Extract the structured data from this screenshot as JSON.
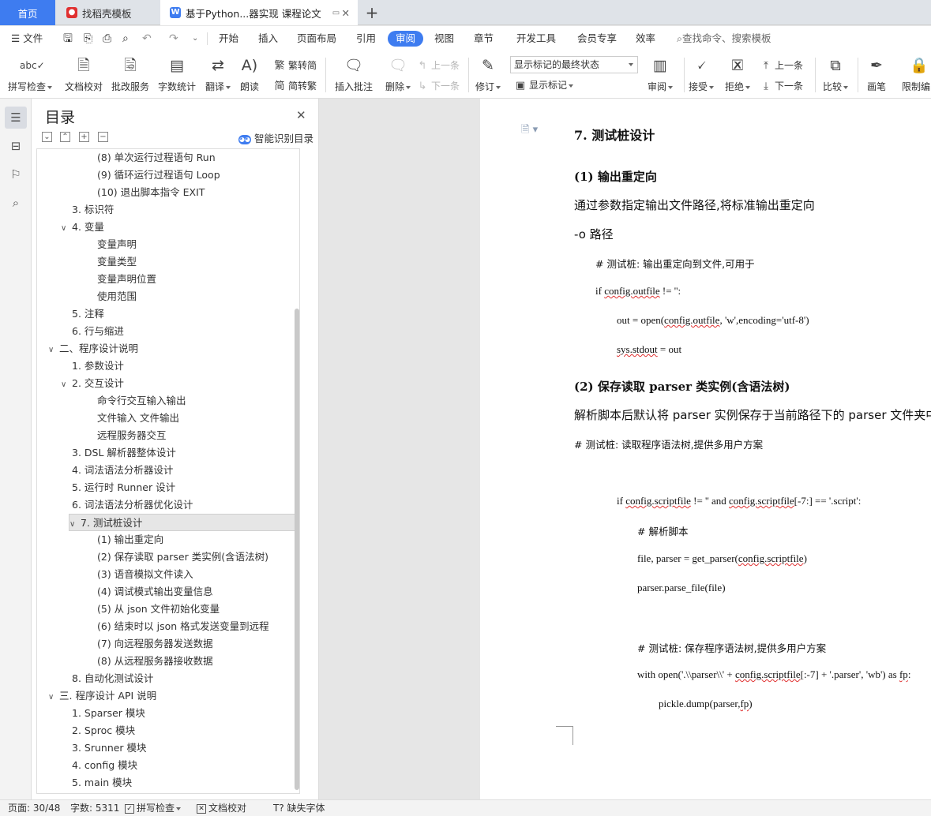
{
  "tabs": {
    "home": "首页",
    "template": "找稻壳模板",
    "document": "基于Python...器实现 课程论文",
    "new_tab": "+"
  },
  "menu": {
    "file": "文件",
    "items": [
      "开始",
      "插入",
      "页面布局",
      "引用",
      "审阅",
      "视图",
      "章节",
      "开发工具",
      "会员专享",
      "效率"
    ],
    "active": "审阅",
    "search": "查找命令、搜索模板"
  },
  "toolbar": {
    "spell_check": "拼写检查",
    "doc_proof": "文档校对",
    "batch_service": "批改服务",
    "word_count": "字数统计",
    "translate": "翻译",
    "read_aloud": "朗读",
    "to_traditional": "繁转简",
    "to_simplified": "简转繁",
    "insert_comment": "插入批注",
    "delete": "删除",
    "prev_comment": "上一条",
    "next_comment": "下一条",
    "track_changes": "修订",
    "mark_state": "显示标记的最终状态",
    "show_markup": "显示标记",
    "review": "审阅",
    "accept": "接受",
    "reject": "拒绝",
    "prev_change": "上一条",
    "next_change": "下一条",
    "compare": "比较",
    "pen": "画笔",
    "restrict_edit": "限制编"
  },
  "toc": {
    "title": "目录",
    "smart_toc": "智能识别目录",
    "items": [
      {
        "label": "(8) 单次运行过程语句 Run",
        "level": 3
      },
      {
        "label": "(9) 循环运行过程语句 Loop",
        "level": 3
      },
      {
        "label": "(10) 退出脚本指令 EXIT",
        "level": 3
      },
      {
        "label": "3. 标识符",
        "level": 2
      },
      {
        "label": "4. 变量",
        "level": 2,
        "expanded": true
      },
      {
        "label": "变量声明",
        "level": 3
      },
      {
        "label": "变量类型",
        "level": 3
      },
      {
        "label": "变量声明位置",
        "level": 3
      },
      {
        "label": "使用范围",
        "level": 3
      },
      {
        "label": "5. 注释",
        "level": 2
      },
      {
        "label": "6. 行与缩进",
        "level": 2
      },
      {
        "label": "二、程序设计说明",
        "level": 1,
        "expanded": true
      },
      {
        "label": "1. 参数设计",
        "level": 2
      },
      {
        "label": "2. 交互设计",
        "level": 2,
        "expanded": true
      },
      {
        "label": "命令行交互输入输出",
        "level": 3
      },
      {
        "label": "文件输入  文件输出",
        "level": 3
      },
      {
        "label": "远程服务器交互",
        "level": 3
      },
      {
        "label": "3. DSL 解析器整体设计",
        "level": 2
      },
      {
        "label": "4. 词法语法分析器设计",
        "level": 2
      },
      {
        "label": "5. 运行时 Runner 设计",
        "level": 2
      },
      {
        "label": "6. 词法语法分析器优化设计",
        "level": 2
      },
      {
        "label": "7. 测试桩设计",
        "level": 2,
        "expanded": true,
        "selected": true
      },
      {
        "label": "(1) 输出重定向",
        "level": 3
      },
      {
        "label": "(2) 保存读取 parser 类实例(含语法树)",
        "level": 3
      },
      {
        "label": "(3) 语音模拟文件读入",
        "level": 3
      },
      {
        "label": "(4) 调试模式输出变量信息",
        "level": 3
      },
      {
        "label": "(5) 从 json 文件初始化变量",
        "level": 3
      },
      {
        "label": "(6) 结束时以 json 格式发送变量到远程",
        "level": 3
      },
      {
        "label": "(7) 向远程服务器发送数据",
        "level": 3
      },
      {
        "label": "(8) 从远程服务器接收数据",
        "level": 3
      },
      {
        "label": "8. 自动化测试设计",
        "level": 2
      },
      {
        "label": "三. 程序设计 API 说明",
        "level": 1,
        "expanded": true
      },
      {
        "label": "1. Sparser  模块",
        "level": 2
      },
      {
        "label": "2. Sproc  模块",
        "level": 2
      },
      {
        "label": "3. Srunner  模块",
        "level": 2
      },
      {
        "label": "4. config  模块",
        "level": 2
      },
      {
        "label": "5. main  模块",
        "level": 2
      }
    ]
  },
  "document": {
    "heading": "7.  测试桩设计",
    "sub1": "(1)  输出重定向",
    "p1": "通过参数指定输出文件路径,将标准输出重定向",
    "p2": "-o  路径",
    "c1_comment": "#  测试桩: 输出重定向到文件,可用于",
    "c1_l1": "if config.outfile != '':",
    "c1_l2": "out = open(config.outfile, 'w',encoding='utf-8')",
    "c1_l3": "sys.stdout = out",
    "sub2": "(2)  保存读取 parser 类实例(含语法树)",
    "p3": "解析脚本后默认将 parser 实例保存于当前路径下的 parser 文件夹中",
    "c2_comment": "#  测试桩: 读取程序语法树,提供多用户方案",
    "c2_l1": "if config.scriptfile != '' and config.scriptfile[-7:] == '.script':",
    "c2_l2": "#  解析脚本",
    "c2_l3": "file, parser = get_parser(config.scriptfile)",
    "c2_l4": "parser.parse_file(file)",
    "c2_l5": "#  测试桩: 保存程序语法树,提供多用户方案",
    "c2_l6": "with open('.\\\\parser\\\\' + config.scriptfile[:-7] + '.parser', 'wb') as fp:",
    "c2_l7": "pickle.dump(parser,fp)"
  },
  "status": {
    "page": "页面: 30/48",
    "words": "字数: 5311",
    "spell_check": "拼写检查",
    "doc_proof": "文档校对",
    "missing_font": "缺失字体"
  },
  "colors": {
    "accent": "#3e7cf0",
    "wps_red": "#e03030",
    "doc_icon": "#3e7cf0"
  }
}
